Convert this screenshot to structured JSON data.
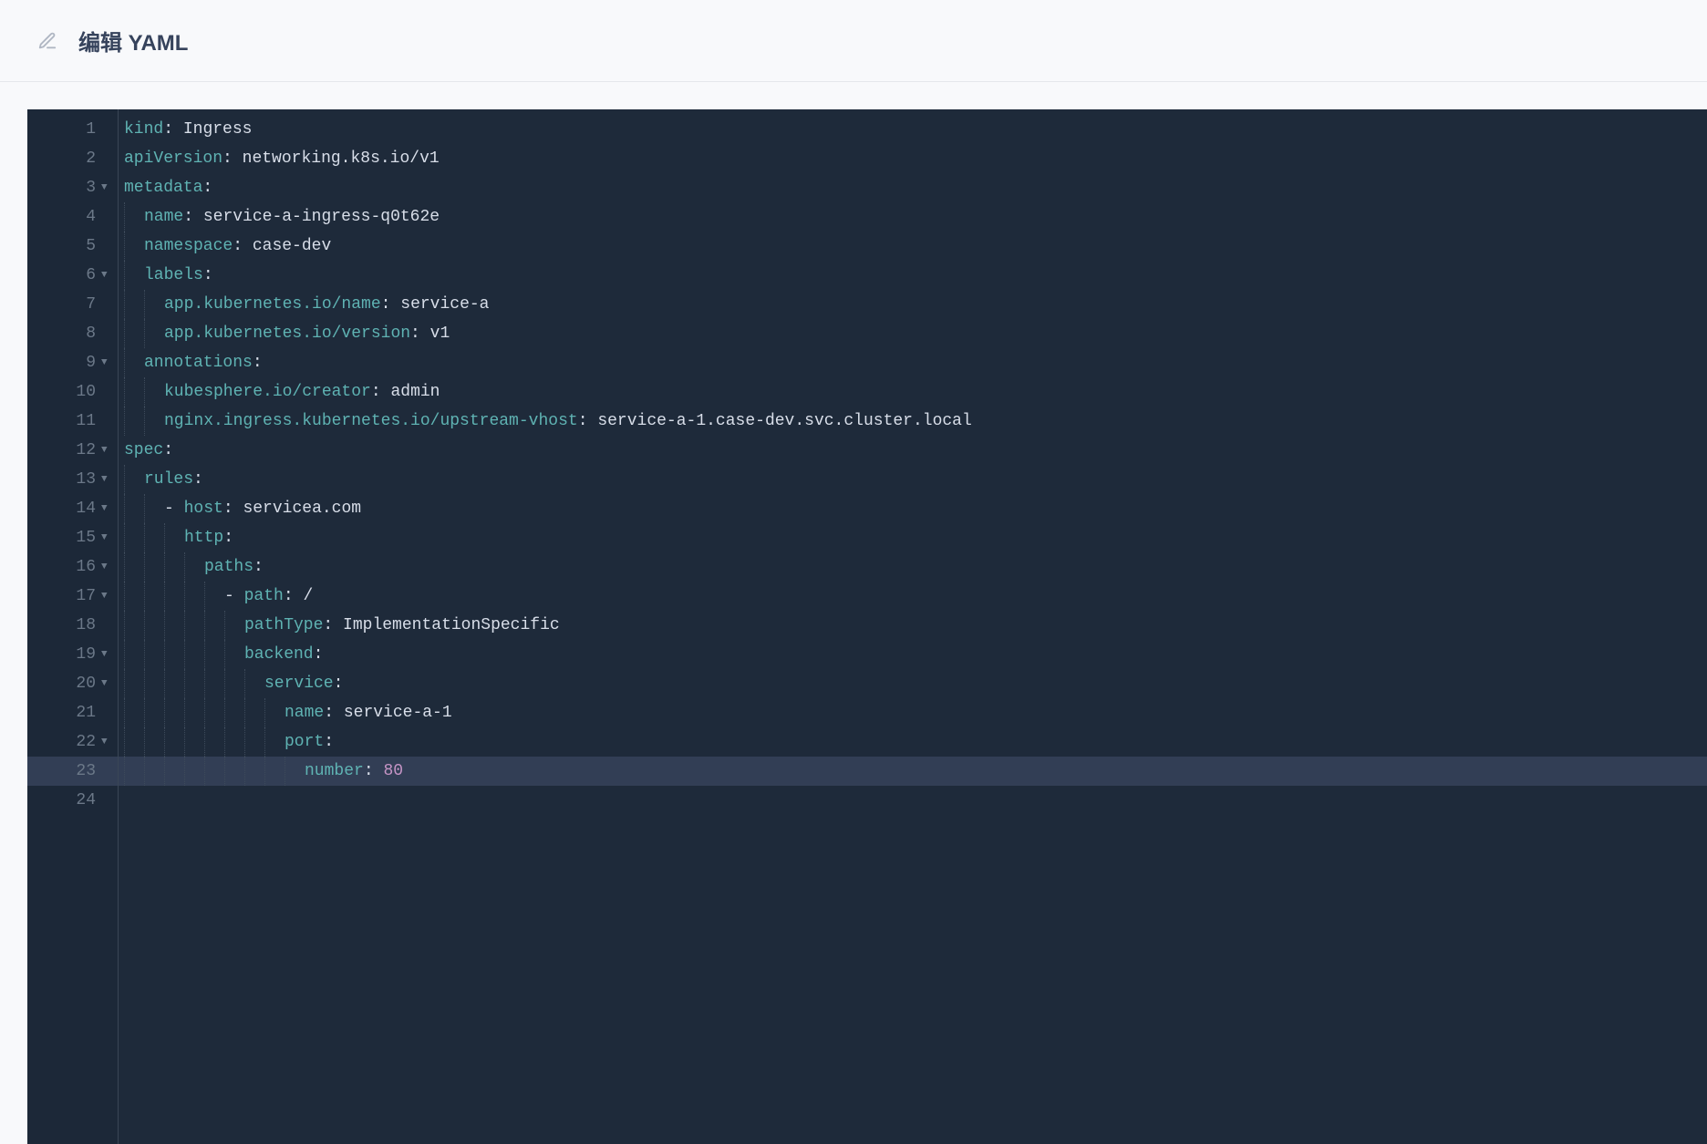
{
  "header": {
    "title": "编辑 YAML"
  },
  "editor": {
    "highlight_line": 23,
    "lines": [
      {
        "n": 1,
        "fold": false,
        "indent": 0,
        "guides": 0,
        "dash": false,
        "key": "kind",
        "val": "Ingress",
        "vtype": "str"
      },
      {
        "n": 2,
        "fold": false,
        "indent": 0,
        "guides": 0,
        "dash": false,
        "key": "apiVersion",
        "val": "networking.k8s.io/v1",
        "vtype": "str"
      },
      {
        "n": 3,
        "fold": true,
        "indent": 0,
        "guides": 0,
        "dash": false,
        "key": "metadata",
        "val": "",
        "vtype": "none"
      },
      {
        "n": 4,
        "fold": false,
        "indent": 1,
        "guides": 1,
        "dash": false,
        "key": "name",
        "val": "service-a-ingress-q0t62e",
        "vtype": "str"
      },
      {
        "n": 5,
        "fold": false,
        "indent": 1,
        "guides": 1,
        "dash": false,
        "key": "namespace",
        "val": "case-dev",
        "vtype": "str"
      },
      {
        "n": 6,
        "fold": true,
        "indent": 1,
        "guides": 1,
        "dash": false,
        "key": "labels",
        "val": "",
        "vtype": "none"
      },
      {
        "n": 7,
        "fold": false,
        "indent": 2,
        "guides": 2,
        "dash": false,
        "key": "app.kubernetes.io/name",
        "val": "service-a",
        "vtype": "str"
      },
      {
        "n": 8,
        "fold": false,
        "indent": 2,
        "guides": 2,
        "dash": false,
        "key": "app.kubernetes.io/version",
        "val": "v1",
        "vtype": "str"
      },
      {
        "n": 9,
        "fold": true,
        "indent": 1,
        "guides": 1,
        "dash": false,
        "key": "annotations",
        "val": "",
        "vtype": "none"
      },
      {
        "n": 10,
        "fold": false,
        "indent": 2,
        "guides": 2,
        "dash": false,
        "key": "kubesphere.io/creator",
        "val": "admin",
        "vtype": "str"
      },
      {
        "n": 11,
        "fold": false,
        "indent": 2,
        "guides": 2,
        "dash": false,
        "key": "nginx.ingress.kubernetes.io/upstream-vhost",
        "val": "service-a-1.case-dev.svc.cluster.local",
        "vtype": "str"
      },
      {
        "n": 12,
        "fold": true,
        "indent": 0,
        "guides": 0,
        "dash": false,
        "key": "spec",
        "val": "",
        "vtype": "none"
      },
      {
        "n": 13,
        "fold": true,
        "indent": 1,
        "guides": 1,
        "dash": false,
        "key": "rules",
        "val": "",
        "vtype": "none"
      },
      {
        "n": 14,
        "fold": true,
        "indent": 2,
        "guides": 2,
        "dash": true,
        "key": "host",
        "val": "servicea.com",
        "vtype": "str"
      },
      {
        "n": 15,
        "fold": true,
        "indent": 3,
        "guides": 3,
        "dash": false,
        "key": "http",
        "val": "",
        "vtype": "none"
      },
      {
        "n": 16,
        "fold": true,
        "indent": 4,
        "guides": 4,
        "dash": false,
        "key": "paths",
        "val": "",
        "vtype": "none"
      },
      {
        "n": 17,
        "fold": true,
        "indent": 5,
        "guides": 5,
        "dash": true,
        "key": "path",
        "val": "/",
        "vtype": "str"
      },
      {
        "n": 18,
        "fold": false,
        "indent": 6,
        "guides": 6,
        "dash": false,
        "key": "pathType",
        "val": "ImplementationSpecific",
        "vtype": "str"
      },
      {
        "n": 19,
        "fold": true,
        "indent": 6,
        "guides": 6,
        "dash": false,
        "key": "backend",
        "val": "",
        "vtype": "none"
      },
      {
        "n": 20,
        "fold": true,
        "indent": 7,
        "guides": 7,
        "dash": false,
        "key": "service",
        "val": "",
        "vtype": "none"
      },
      {
        "n": 21,
        "fold": false,
        "indent": 8,
        "guides": 8,
        "dash": false,
        "key": "name",
        "val": "service-a-1",
        "vtype": "str"
      },
      {
        "n": 22,
        "fold": true,
        "indent": 8,
        "guides": 8,
        "dash": false,
        "key": "port",
        "val": "",
        "vtype": "none"
      },
      {
        "n": 23,
        "fold": false,
        "indent": 9,
        "guides": 9,
        "dash": false,
        "key": "number",
        "val": "80",
        "vtype": "num"
      },
      {
        "n": 24,
        "fold": false,
        "indent": 0,
        "guides": 0,
        "dash": false,
        "key": "",
        "val": "",
        "vtype": "empty"
      }
    ]
  }
}
